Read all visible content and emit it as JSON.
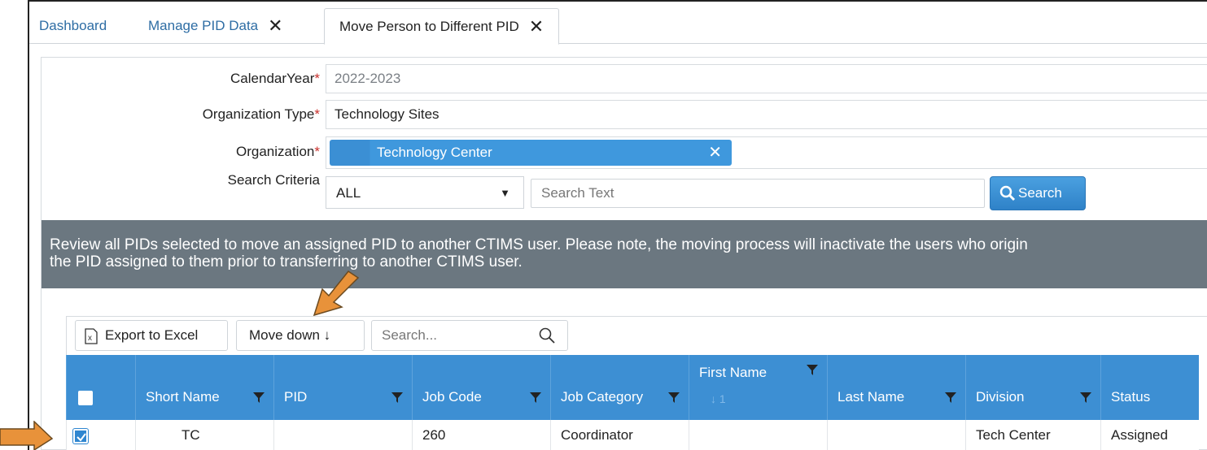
{
  "tabs": [
    {
      "label": "Dashboard",
      "closable": false
    },
    {
      "label": "Manage PID Data",
      "closable": true
    },
    {
      "label": "Move Person to Different PID",
      "closable": true,
      "active": true
    }
  ],
  "form": {
    "calendar_year": {
      "label": "CalendarYear",
      "value": "2022-2023"
    },
    "organization_type": {
      "label": "Organization Type",
      "value": "Technology Sites"
    },
    "organization": {
      "label": "Organization",
      "tag": "Technology Center"
    },
    "search_criteria": {
      "label": "Search Criteria",
      "selected": "ALL",
      "placeholder": "Search Text",
      "button": "Search"
    },
    "required_mark": "*"
  },
  "banner": {
    "line1": "Review all PIDs selected to move an assigned PID to another CTIMS user. Please note, the moving process will inactivate the users who origin",
    "line2": "the PID assigned to them prior to transferring to another CTIMS user."
  },
  "grid": {
    "toolbar": {
      "export": "Export to Excel",
      "move": "Move down",
      "search_placeholder": "Search..."
    },
    "columns": [
      "Short Name",
      "PID",
      "Job Code",
      "Job Category",
      "First Name",
      "Last Name",
      "Division",
      "Status"
    ],
    "first_name_sort": "↓ 1",
    "rows": [
      {
        "checked": true,
        "short_name": "TC",
        "pid": "",
        "job_code": "260",
        "job_category": "Coordinator",
        "first_name": "",
        "last_name": "",
        "division": "Tech Center",
        "status": "Assigned"
      }
    ]
  },
  "colors": {
    "accent": "#3d8fd3",
    "banner": "#6b7780",
    "arrow": "#e8923a",
    "required": "#c9302c"
  },
  "icons": [
    "close-icon",
    "search-icon",
    "excel-icon",
    "arrow-down-icon",
    "filter-icon",
    "checkbox-icon",
    "callout-arrow-icon"
  ]
}
